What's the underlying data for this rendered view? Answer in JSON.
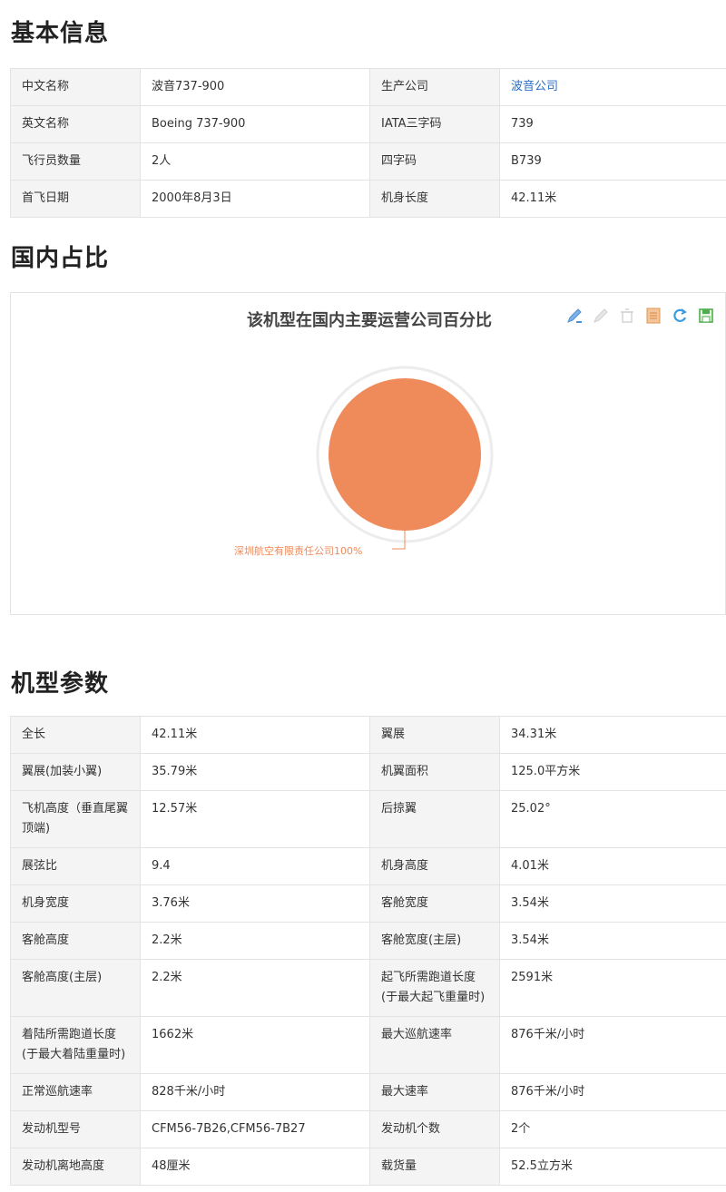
{
  "basic": {
    "title": "基本信息",
    "rows": [
      {
        "k1": "中文名称",
        "v1": "波音737-900",
        "k2": "生产公司",
        "v2": "波音公司"
      },
      {
        "k1": "英文名称",
        "v1": "Boeing 737-900",
        "k2": "IATA三字码",
        "v2": "739"
      },
      {
        "k1": "飞行员数量",
        "v1": "2人",
        "k2": "四字码",
        "v2": "B739"
      },
      {
        "k1": "首飞日期",
        "v1": "2000年8月3日",
        "k2": "机身长度",
        "v2": "42.11米"
      }
    ]
  },
  "share": {
    "title": "国内占比",
    "toolbox_icons": [
      "mark-pen-icon",
      "undo-mark-icon",
      "clear-mark-icon",
      "data-view-icon",
      "restore-icon",
      "save-image-icon"
    ],
    "chart_data": {
      "type": "pie",
      "title": "该机型在国内主要运营公司百分比",
      "slices": [
        {
          "name": "深圳航空有限责任公司",
          "value": 100
        }
      ],
      "label": "深圳航空有限责任公司100%",
      "colors": [
        "#ef8a5a"
      ]
    }
  },
  "params": {
    "title": "机型参数",
    "rows": [
      {
        "k1": "全长",
        "v1": "42.11米",
        "k2": "翼展",
        "v2": "34.31米"
      },
      {
        "k1": "翼展(加装小翼)",
        "v1": "35.79米",
        "k2": "机翼面积",
        "v2": "125.0平方米"
      },
      {
        "k1": "飞机高度（垂直尾翼顶端)",
        "v1": "12.57米",
        "k2": "后掠翼",
        "v2": "25.02°"
      },
      {
        "k1": "展弦比",
        "v1": "9.4",
        "k2": "机身高度",
        "v2": "4.01米"
      },
      {
        "k1": "机身宽度",
        "v1": "3.76米",
        "k2": "客舱宽度",
        "v2": "3.54米"
      },
      {
        "k1": "客舱高度",
        "v1": "2.2米",
        "k2": "客舱宽度(主层)",
        "v2": "3.54米"
      },
      {
        "k1": "客舱高度(主层)",
        "v1": "2.2米",
        "k2": "起飞所需跑道长度(于最大起飞重量时)",
        "v2": "2591米"
      },
      {
        "k1": "着陆所需跑道长度(于最大着陆重量时)",
        "v1": "1662米",
        "k2": "最大巡航速率",
        "v2": "876千米/小时"
      },
      {
        "k1": "正常巡航速率",
        "v1": "828千米/小时",
        "k2": "最大速率",
        "v2": "876千米/小时"
      },
      {
        "k1": "发动机型号",
        "v1": "CFM56-7B26,CFM56-7B27",
        "k2": "发动机个数",
        "v2": "2个"
      },
      {
        "k1": "发动机离地高度",
        "v1": "48厘米",
        "k2": "载货量",
        "v2": "52.5立方米"
      }
    ]
  }
}
